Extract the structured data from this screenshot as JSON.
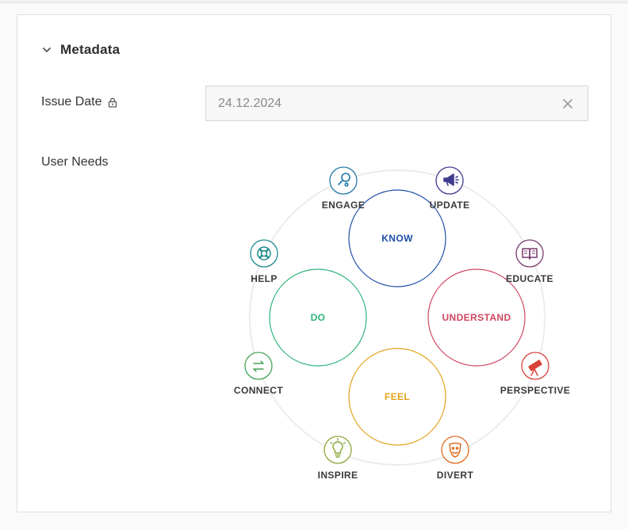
{
  "section": {
    "title": "Metadata"
  },
  "issue_date": {
    "label": "Issue Date",
    "value": "24.12.2024"
  },
  "user_needs": {
    "label": "User Needs",
    "categories": [
      {
        "key": "know",
        "label": "KNOW",
        "color": "#1e4fa8"
      },
      {
        "key": "understand",
        "label": "UNDERSTAND",
        "color": "#cf4660"
      },
      {
        "key": "feel",
        "label": "FEEL",
        "color": "#e3a21b"
      },
      {
        "key": "do",
        "label": "DO",
        "color": "#2fb57a"
      }
    ],
    "needs": [
      {
        "key": "engage",
        "label": "ENGAGE",
        "icon": "magnifier-icon",
        "color": "#2277a8"
      },
      {
        "key": "update",
        "label": "UPDATE",
        "icon": "megaphone-icon",
        "color": "#3e3b8f"
      },
      {
        "key": "educate",
        "label": "EDUCATE",
        "icon": "book-icon",
        "color": "#7a3a6e"
      },
      {
        "key": "perspective",
        "label": "PERSPECTIVE",
        "icon": "telescope-icon",
        "color": "#d9443a"
      },
      {
        "key": "divert",
        "label": "DIVERT",
        "icon": "mask-icon",
        "color": "#e06b1f"
      },
      {
        "key": "inspire",
        "label": "INSPIRE",
        "icon": "lightbulb-icon",
        "color": "#8aa63a"
      },
      {
        "key": "connect",
        "label": "CONNECT",
        "icon": "arrows-icon",
        "color": "#45a35a"
      },
      {
        "key": "help",
        "label": "HELP",
        "icon": "lifebuoy-icon",
        "color": "#1f8a8c"
      }
    ]
  }
}
